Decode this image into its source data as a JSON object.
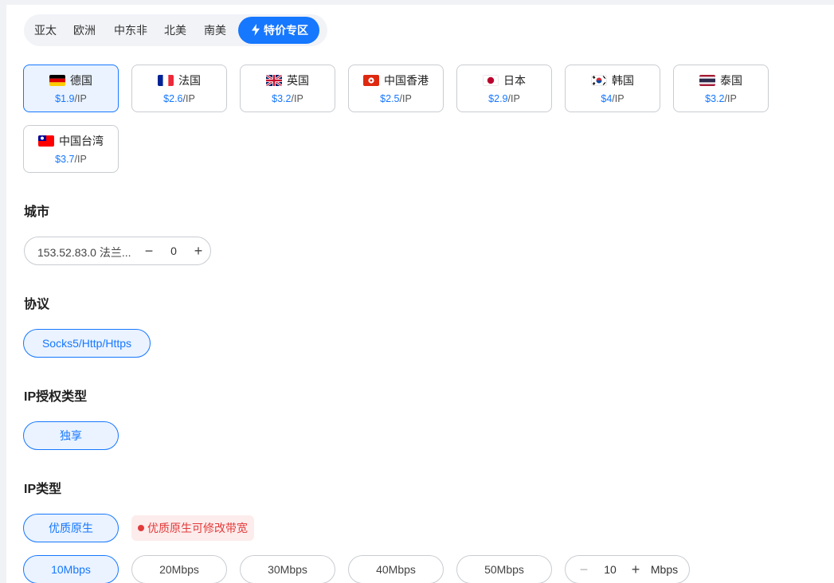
{
  "regions": [
    {
      "label": "亚太"
    },
    {
      "label": "欧洲"
    },
    {
      "label": "中东非"
    },
    {
      "label": "北美"
    },
    {
      "label": "南美"
    },
    {
      "label": "特价专区",
      "active": true,
      "icon": "bolt-icon"
    }
  ],
  "countries": [
    {
      "name": "德国",
      "price": "$1.9",
      "unit": "/IP",
      "flag": "germany-flag-icon",
      "selected": true
    },
    {
      "name": "法国",
      "price": "$2.6",
      "unit": "/IP",
      "flag": "france-flag-icon"
    },
    {
      "name": "英国",
      "price": "$3.2",
      "unit": "/IP",
      "flag": "uk-flag-icon"
    },
    {
      "name": "中国香港",
      "price": "$2.5",
      "unit": "/IP",
      "flag": "hongkong-flag-icon"
    },
    {
      "name": "日本",
      "price": "$2.9",
      "unit": "/IP",
      "flag": "japan-flag-icon"
    },
    {
      "name": "韩国",
      "price": "$4",
      "unit": "/IP",
      "flag": "korea-flag-icon"
    },
    {
      "name": "泰国",
      "price": "$3.2",
      "unit": "/IP",
      "flag": "thailand-flag-icon"
    },
    {
      "name": "中国台湾",
      "price": "$3.7",
      "unit": "/IP",
      "flag": "taiwan-flag-icon"
    }
  ],
  "city": {
    "title": "城市",
    "value": "153.52.83.0 法兰...",
    "minus": "−",
    "quantity": "0",
    "plus": "+"
  },
  "protocol": {
    "title": "协议",
    "options": [
      {
        "label": "Socks5/Http/Https",
        "selected": true
      }
    ]
  },
  "auth": {
    "title": "IP授权类型",
    "options": [
      {
        "label": "独享",
        "selected": true
      }
    ]
  },
  "ip_type": {
    "title": "IP类型",
    "options": [
      {
        "label": "优质原生",
        "selected": true
      }
    ],
    "badge": "优质原生可修改带宽"
  },
  "bandwidth": {
    "options": [
      {
        "label": "10Mbps",
        "selected": true
      },
      {
        "label": "20Mbps"
      },
      {
        "label": "30Mbps"
      },
      {
        "label": "40Mbps"
      },
      {
        "label": "50Mbps"
      }
    ],
    "custom": {
      "minus": "−",
      "value": "10",
      "plus": "+",
      "unit": "Mbps"
    }
  },
  "colors": {
    "accent": "#1677ff",
    "accent_bg": "#eaf3ff",
    "warning": "#e23b3b"
  }
}
